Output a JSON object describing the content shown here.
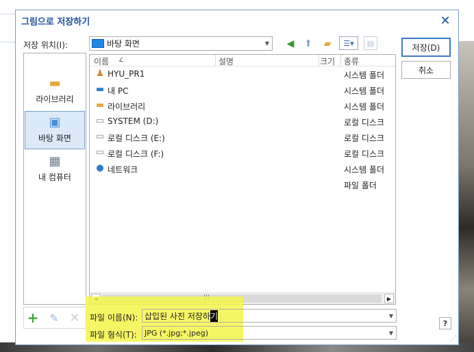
{
  "dialog": {
    "title": "그림으로 저장하기",
    "close": "✕"
  },
  "location": {
    "label": "저장 위치(I):",
    "value": "바탕 화면"
  },
  "places": [
    {
      "label": "라이브러리"
    },
    {
      "label": "바탕 화면"
    },
    {
      "label": "내 컴퓨터"
    }
  ],
  "columns": {
    "name": "이름",
    "desc": "설명",
    "size": "크기",
    "type": "종류"
  },
  "files": [
    {
      "name": "HYU_PR1",
      "type": "시스템 폴더",
      "icon": "user-folder-icon"
    },
    {
      "name": "내 PC",
      "type": "시스템 폴더",
      "icon": "pc-icon"
    },
    {
      "name": "라이브러리",
      "type": "시스템 폴더",
      "icon": "library-icon"
    },
    {
      "name": "SYSTEM (D:)",
      "type": "로컬 디스크",
      "icon": "drive-icon"
    },
    {
      "name": "로컬 디스크 (E:)",
      "type": "로컬 디스크",
      "icon": "drive-icon"
    },
    {
      "name": "로컬 디스크 (F:)",
      "type": "로컬 디스크",
      "icon": "drive-icon"
    },
    {
      "name": "네트워크",
      "type": "시스템 폴더",
      "icon": "network-icon"
    },
    {
      "name": "",
      "type": "파일 폴더",
      "icon": ""
    }
  ],
  "filename": {
    "label": "파일 이름(N):",
    "value_main": "삽입된 사진 저장하",
    "value_cursor": "기"
  },
  "filetype": {
    "label": "파일 형식(T):",
    "value": "JPG (*.jpg;*.jpeg)"
  },
  "buttons": {
    "save": "저장(D)",
    "cancel": "취소",
    "help": "?"
  },
  "colors": {
    "accent": "#1b4f9c",
    "highlight": "#f5f54a",
    "selection": "#dbe9f8"
  }
}
